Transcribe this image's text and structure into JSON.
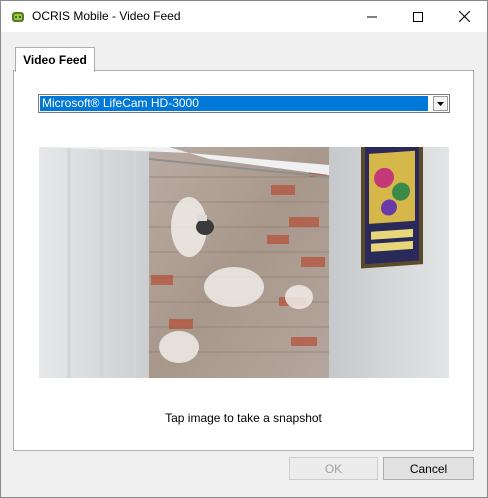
{
  "window": {
    "title": "OCRIS Mobile - Video Feed",
    "app_icon": "ocris-app-icon",
    "controls": [
      "minimize-icon",
      "maximize-icon",
      "close-icon"
    ]
  },
  "tabs": [
    {
      "label": "Video Feed",
      "selected": true
    }
  ],
  "camera_select": {
    "selected": "Microsoft® LifeCam HD-3000",
    "highlight_color": "#0078d7"
  },
  "video": {
    "hint": "Tap image to take a snapshot"
  },
  "buttons": {
    "ok": {
      "label": "OK",
      "enabled": false
    },
    "cancel": {
      "label": "Cancel",
      "enabled": true
    }
  }
}
